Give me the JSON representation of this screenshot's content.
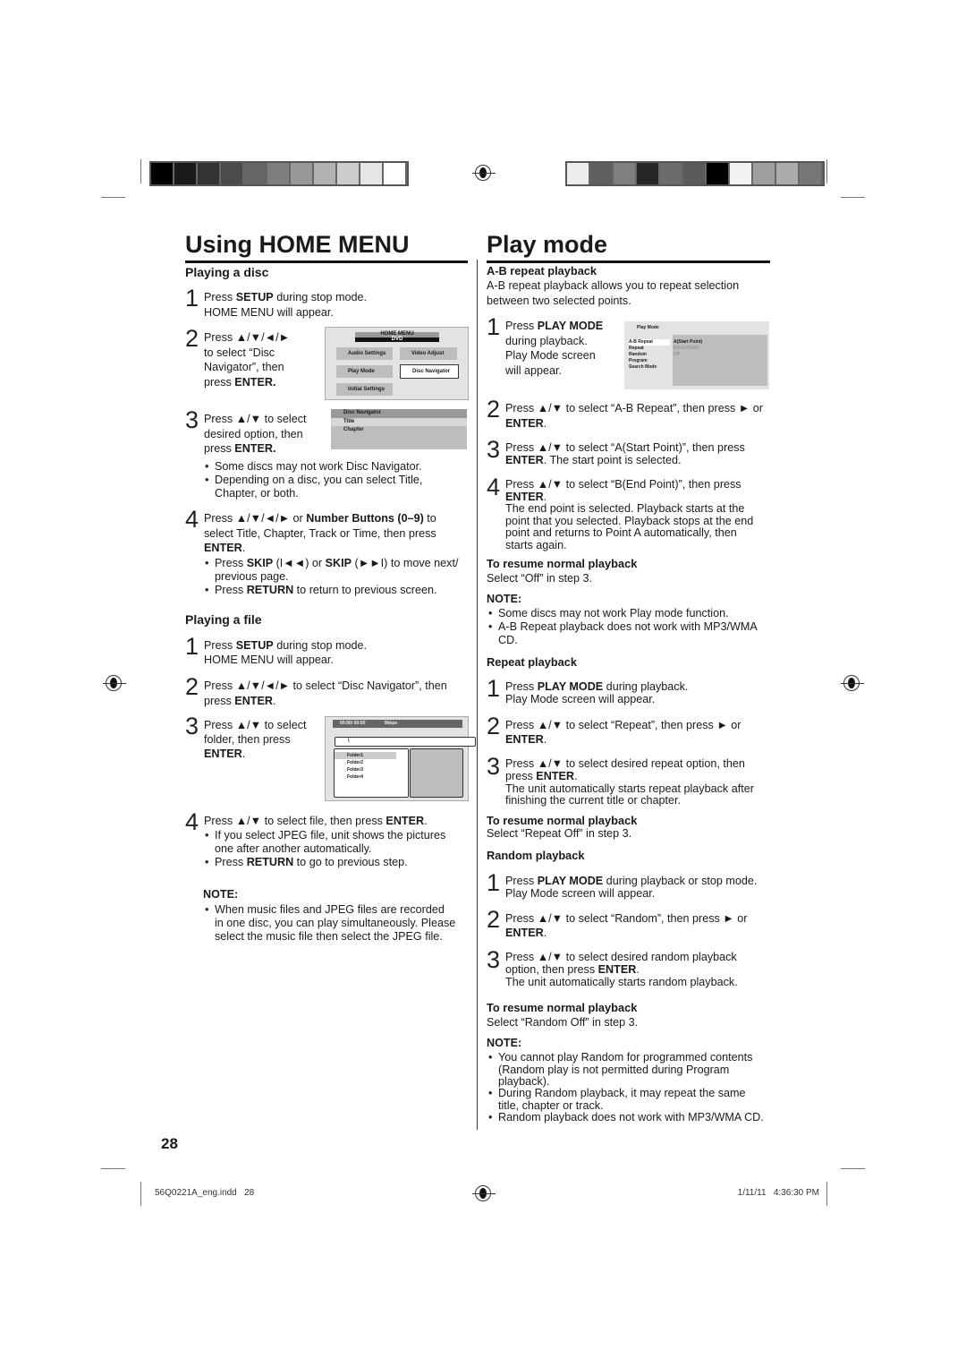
{
  "page_number": "28",
  "footer": {
    "file": "56Q0221A_eng.indd   28",
    "date": "1/11/11   4:36:30 PM"
  },
  "colors": {
    "bars_left": [
      "#000",
      "#1a1a1a",
      "#333",
      "#4b4b4b",
      "#656565",
      "#7e7e7e",
      "#989898",
      "#b2b2b2",
      "#cccccc",
      "#e6e6e6",
      "#ffffff"
    ],
    "bars_right": [
      "#ececec",
      "#5f5f5f",
      "#7f7f7f",
      "#272727",
      "#6b6b6b",
      "#5a5a5a",
      "#000000",
      "#f2f2f2",
      "#9f9f9f",
      "#ababab",
      "#777777"
    ]
  },
  "left": {
    "title": "Using HOME MENU",
    "blocks": [
      {
        "type": "heading",
        "text": "Playing a disc"
      },
      {
        "type": "step",
        "num": "1",
        "text": "Press **SETUP** during stop mode.\nHOME MENU will appear."
      },
      {
        "type": "step",
        "num": "2",
        "text": "Press ▲/▼/◄/►\nto select “Disc\nNavigator”, then\npress **ENTER.**"
      },
      {
        "type": "step",
        "num": "3",
        "text": "Press ▲/▼ to select\ndesired option, then\npress **ENTER.**"
      },
      {
        "type": "bullet",
        "text": "Some discs may not work Disc Navigator."
      },
      {
        "type": "bullet",
        "text": "Depending on a disc, you can select Title,\nChapter, or both."
      },
      {
        "type": "step",
        "num": "4",
        "text": "Press ▲/▼/◄/► or **Number Buttons (0–9)** to\nselect Title, Chapter, Track or Time, then press\n**ENTER**."
      },
      {
        "type": "bullet",
        "text": "Press **SKIP** (I◄◄) or **SKIP** (►►I) to move next/\nprevious page."
      },
      {
        "type": "bullet",
        "text": "Press **RETURN** to return to previous screen."
      },
      {
        "type": "heading",
        "text": "Playing a file"
      },
      {
        "type": "step",
        "num": "1",
        "text": "Press **SETUP** during stop mode.\nHOME MENU will appear."
      },
      {
        "type": "step",
        "num": "2",
        "text": "Press ▲/▼/◄/► to select “Disc Navigator”, then\npress **ENTER**."
      },
      {
        "type": "step",
        "num": "3",
        "text": "Press ▲/▼ to select\nfolder, then press\n**ENTER**."
      },
      {
        "type": "step",
        "num": "4",
        "text": "Press ▲/▼ to select file, then press **ENTER**."
      },
      {
        "type": "bullet",
        "text": "If you select JPEG file, unit shows the pictures\none after another automatically."
      },
      {
        "type": "bullet",
        "text": "Press **RETURN** to go to previous step."
      },
      {
        "type": "note",
        "text": "NOTE:"
      },
      {
        "type": "bullet",
        "text": "When music files and JPEG files are recorded\nin one disc, you can play simultaneously. Please\nselect the music file then select the JPEG file."
      }
    ]
  },
  "right": {
    "title": "Play mode",
    "blocks": [
      {
        "type": "heading",
        "text": "A-B repeat playback"
      },
      {
        "type": "para",
        "text": "A-B repeat playback allows you to repeat selection\nbetween two selected points."
      },
      {
        "type": "step",
        "num": "1",
        "text": "Press **PLAY MODE**\nduring playback.\nPlay Mode screen\nwill appear."
      },
      {
        "type": "step",
        "num": "2",
        "text": "Press ▲/▼ to select “A-B Repeat”, then press ► or\n**ENTER**."
      },
      {
        "type": "step",
        "num": "3",
        "text": "Press ▲/▼ to select “A(Start Point)”, then press\n**ENTER**. The start point is selected."
      },
      {
        "type": "step",
        "num": "4",
        "text": "Press ▲/▼ to select “B(End Point)”, then press\n**ENTER**.\nThe end point is selected. Playback starts at the\npoint that you selected. Playback stops at the end\npoint and returns to Point A automatically, then\nstarts again."
      },
      {
        "type": "heading",
        "text": "To resume normal playback"
      },
      {
        "type": "para",
        "text": "Select “Off” in step 3."
      },
      {
        "type": "note",
        "text": "NOTE:"
      },
      {
        "type": "bullet",
        "text": "Some discs may not work Play mode function."
      },
      {
        "type": "bullet",
        "text": "A-B Repeat playback does not work with MP3/WMA\nCD."
      },
      {
        "type": "heading",
        "text": "Repeat playback"
      },
      {
        "type": "step",
        "num": "1",
        "text": "Press **PLAY MODE** during playback.\nPlay Mode screen will appear."
      },
      {
        "type": "step",
        "num": "2",
        "text": "Press ▲/▼ to select “Repeat”, then press ► or\n**ENTER**."
      },
      {
        "type": "step",
        "num": "3",
        "text": "Press ▲/▼ to select desired repeat option, then\npress **ENTER**.\nThe unit automatically starts repeat playback after\nfinishing the current title or chapter."
      },
      {
        "type": "heading",
        "text": "To resume normal playback"
      },
      {
        "type": "para",
        "text": "Select “Repeat Off” in step 3."
      },
      {
        "type": "heading",
        "text": "Random playback"
      },
      {
        "type": "step",
        "num": "1",
        "text": "Press **PLAY MODE** during playback or stop mode.\nPlay Mode screen will appear."
      },
      {
        "type": "step",
        "num": "2",
        "text": "Press ▲/▼ to select “Random”, then press ► or\n**ENTER**."
      },
      {
        "type": "step",
        "num": "3",
        "text": "Press ▲/▼ to select desired random playback\noption, then press **ENTER**.\nThe unit automatically starts random playback."
      },
      {
        "type": "heading",
        "text": "To resume normal playback"
      },
      {
        "type": "para",
        "text": "Select “Random Off” in step 3."
      },
      {
        "type": "note",
        "text": "NOTE:"
      },
      {
        "type": "bullet",
        "text": "You cannot play Random for programmed contents\n(Random play is not permitted during Program\nplayback)."
      },
      {
        "type": "bullet",
        "text": "During Random playback, it may repeat the same\ntitle, chapter or track."
      },
      {
        "type": "bullet",
        "text": "Random playback does not work with MP3/WMA CD."
      }
    ]
  },
  "screens": {
    "home_menu": {
      "title": "HOME MENU",
      "sub": "DVD",
      "items": [
        "Audio Settings",
        "Video Adjust",
        "Play Mode",
        "Disc Navigator",
        "Initial Settings"
      ]
    },
    "disc_nav": {
      "title": "Disc Navigator",
      "items": [
        "Title",
        "Chapter"
      ]
    },
    "file": {
      "time": "00:00/ 00:00",
      "rate": "0kbps",
      "path": "\\",
      "folders": [
        "Folder1",
        "Folder2",
        "Folder3",
        "Folder4"
      ]
    },
    "play_mode": {
      "title": "Play Mode",
      "items": [
        "A-B Repeat",
        "Repeat",
        "Random",
        "Program",
        "Search Mode"
      ],
      "options": [
        "A(Start Point)",
        "B(End Point)",
        "Off"
      ]
    }
  }
}
